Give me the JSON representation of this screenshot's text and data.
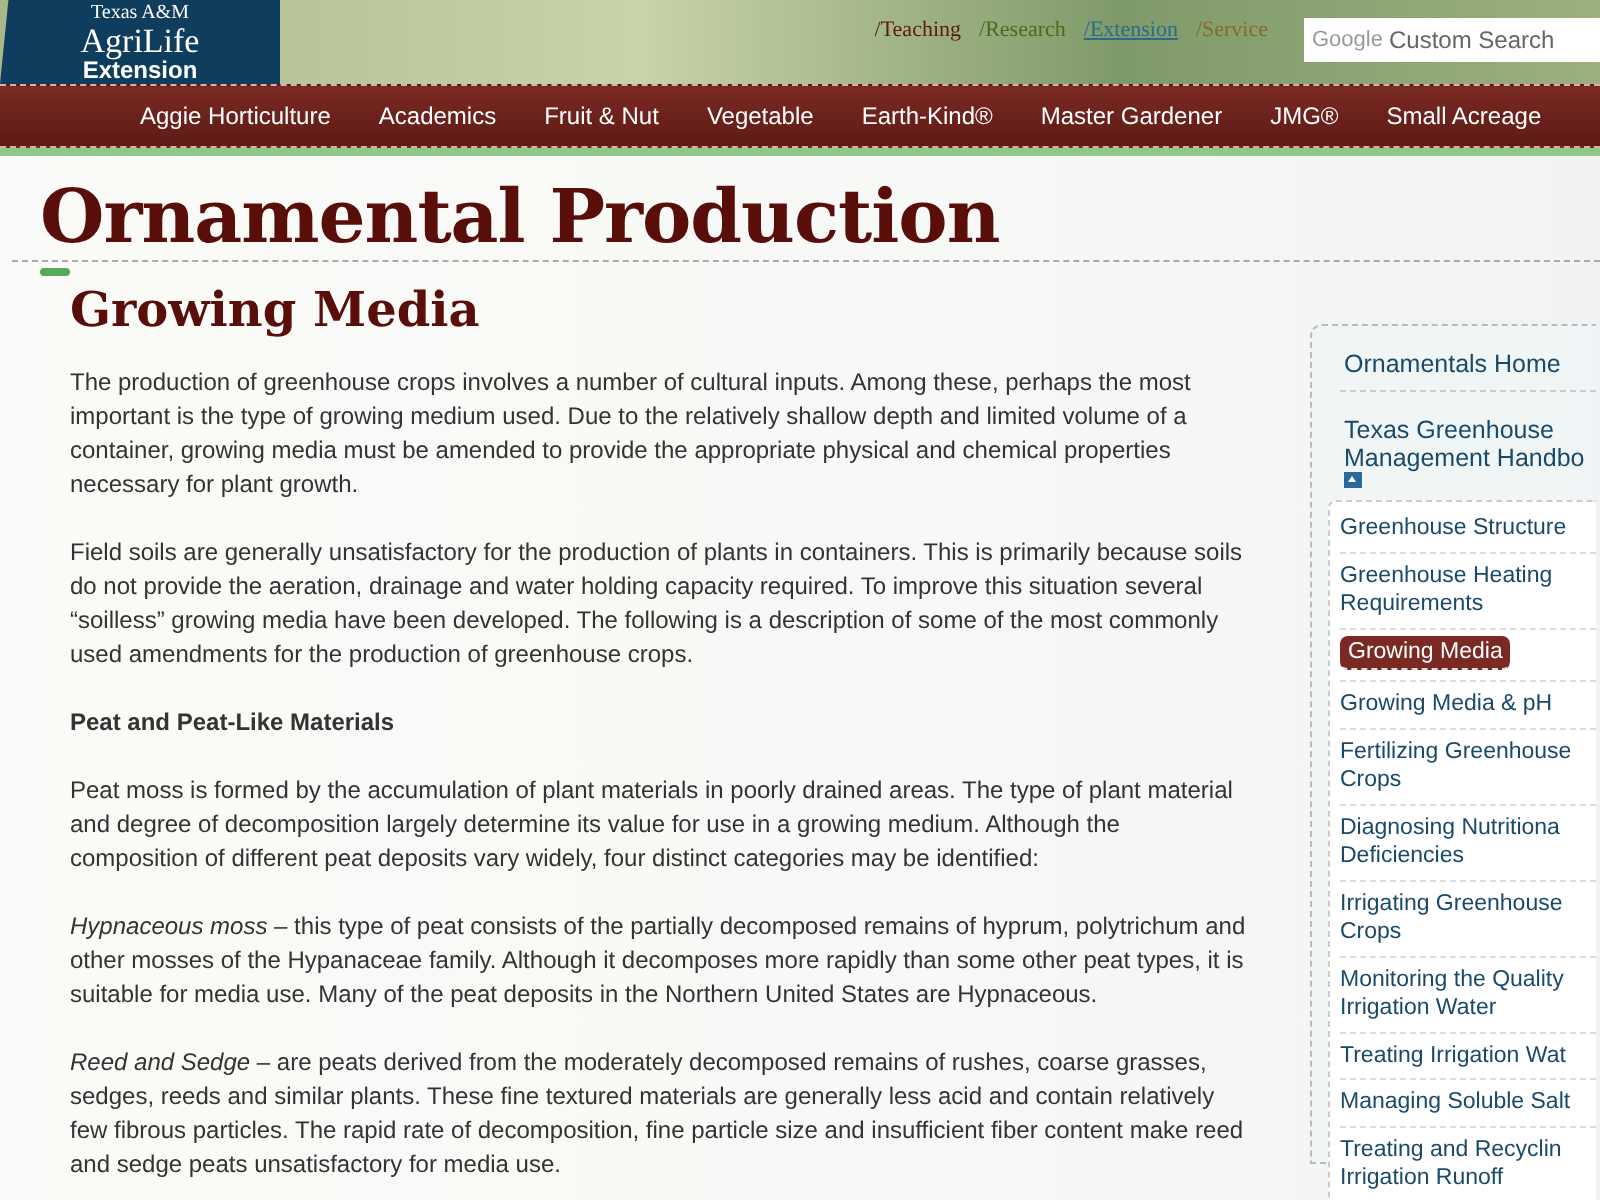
{
  "header": {
    "logo": {
      "line_1": "Texas A&M",
      "line_2": "AgriLife",
      "line_3": "Extension"
    },
    "top_links": [
      {
        "label": "/Teaching",
        "color": "#5a1a14",
        "selected": false
      },
      {
        "label": "/Research",
        "color": "#4a6a22",
        "selected": false
      },
      {
        "label": "/Extension",
        "color": "#2a6a8a",
        "selected": true
      },
      {
        "label": "/Service",
        "color": "#8a6a2a",
        "selected": false
      }
    ],
    "search": {
      "brand": "Google",
      "placeholder": "Custom Search"
    }
  },
  "nav": [
    "Aggie Horticulture",
    "Academics",
    "Fruit & Nut",
    "Vegetable",
    "Earth-Kind®",
    "Master Gardener",
    "JMG®",
    "Small Acreage"
  ],
  "page_title": "Ornamental Production",
  "article": {
    "title": "Growing Media",
    "blocks": [
      {
        "kind": "paragraph",
        "text": "The production of greenhouse crops involves a number of cultural inputs. Among these, perhaps the most important is the type of growing medium used. Due to the relatively shallow depth and limited volume of a container, growing media must be amended to provide the appropriate physical and chemical properties necessary for plant growth."
      },
      {
        "kind": "paragraph",
        "text": "Field soils are generally unsatisfactory for the production of plants in containers. This is primarily because soils do not provide the aeration, drainage and water holding capacity required. To improve this situation several “soilless” growing media have been developed. The following is a description of some of the most commonly used amendments for the production of greenhouse crops."
      },
      {
        "kind": "heading",
        "text": "Peat and Peat-Like Materials"
      },
      {
        "kind": "paragraph",
        "text": "Peat moss is formed by the accumulation of plant materials in poorly drained areas. The type of plant material and degree of decomposition largely determine its value for use in a growing medium. Although the composition of different peat deposits vary widely, four distinct categories may be identified:"
      },
      {
        "kind": "paragraph",
        "text": "*Hypnaceous moss* – this type of peat consists of the partially decomposed remains of hyprum, polytrichum and other mosses of the Hypanaceae family. Although it decomposes more rapidly than some other peat types, it is suitable for media use. Many of the peat deposits in the Northern United States are Hypnaceous."
      },
      {
        "kind": "paragraph",
        "text": "*Reed and Sedge* – are peats derived from the moderately decomposed remains of rushes, coarse grasses, sedges, reeds and similar plants. These fine textured materials are generally less acid and contain relatively few fibrous particles. The rapid rate of decomposition, fine particle size and insufficient fiber content make reed and sedge peats unsatisfactory for media use."
      }
    ]
  },
  "sidebar": {
    "items": [
      {
        "label": "Ornamentals Home"
      },
      {
        "label": "Texas Greenhouse Management Handbo",
        "expanded": true,
        "children": [
          {
            "label": "Greenhouse Structure",
            "selected": false
          },
          {
            "label": "Greenhouse Heating Requirements",
            "selected": false
          },
          {
            "label": "Growing Media",
            "selected": true
          },
          {
            "label": "Growing Media & pH",
            "selected": false
          },
          {
            "label": "Fertilizing Greenhouse Crops",
            "selected": false
          },
          {
            "label": "Diagnosing Nutritiona Deficiencies",
            "selected": false
          },
          {
            "label": "Irrigating Greenhouse Crops",
            "selected": false
          },
          {
            "label": "Monitoring the Quality Irrigation Water",
            "selected": false
          },
          {
            "label": "Treating Irrigation Wat",
            "selected": false
          },
          {
            "label": "Managing Soluble Salt",
            "selected": false
          },
          {
            "label": "Treating and Recyclin Irrigation Runoff",
            "selected": false
          }
        ]
      }
    ]
  }
}
